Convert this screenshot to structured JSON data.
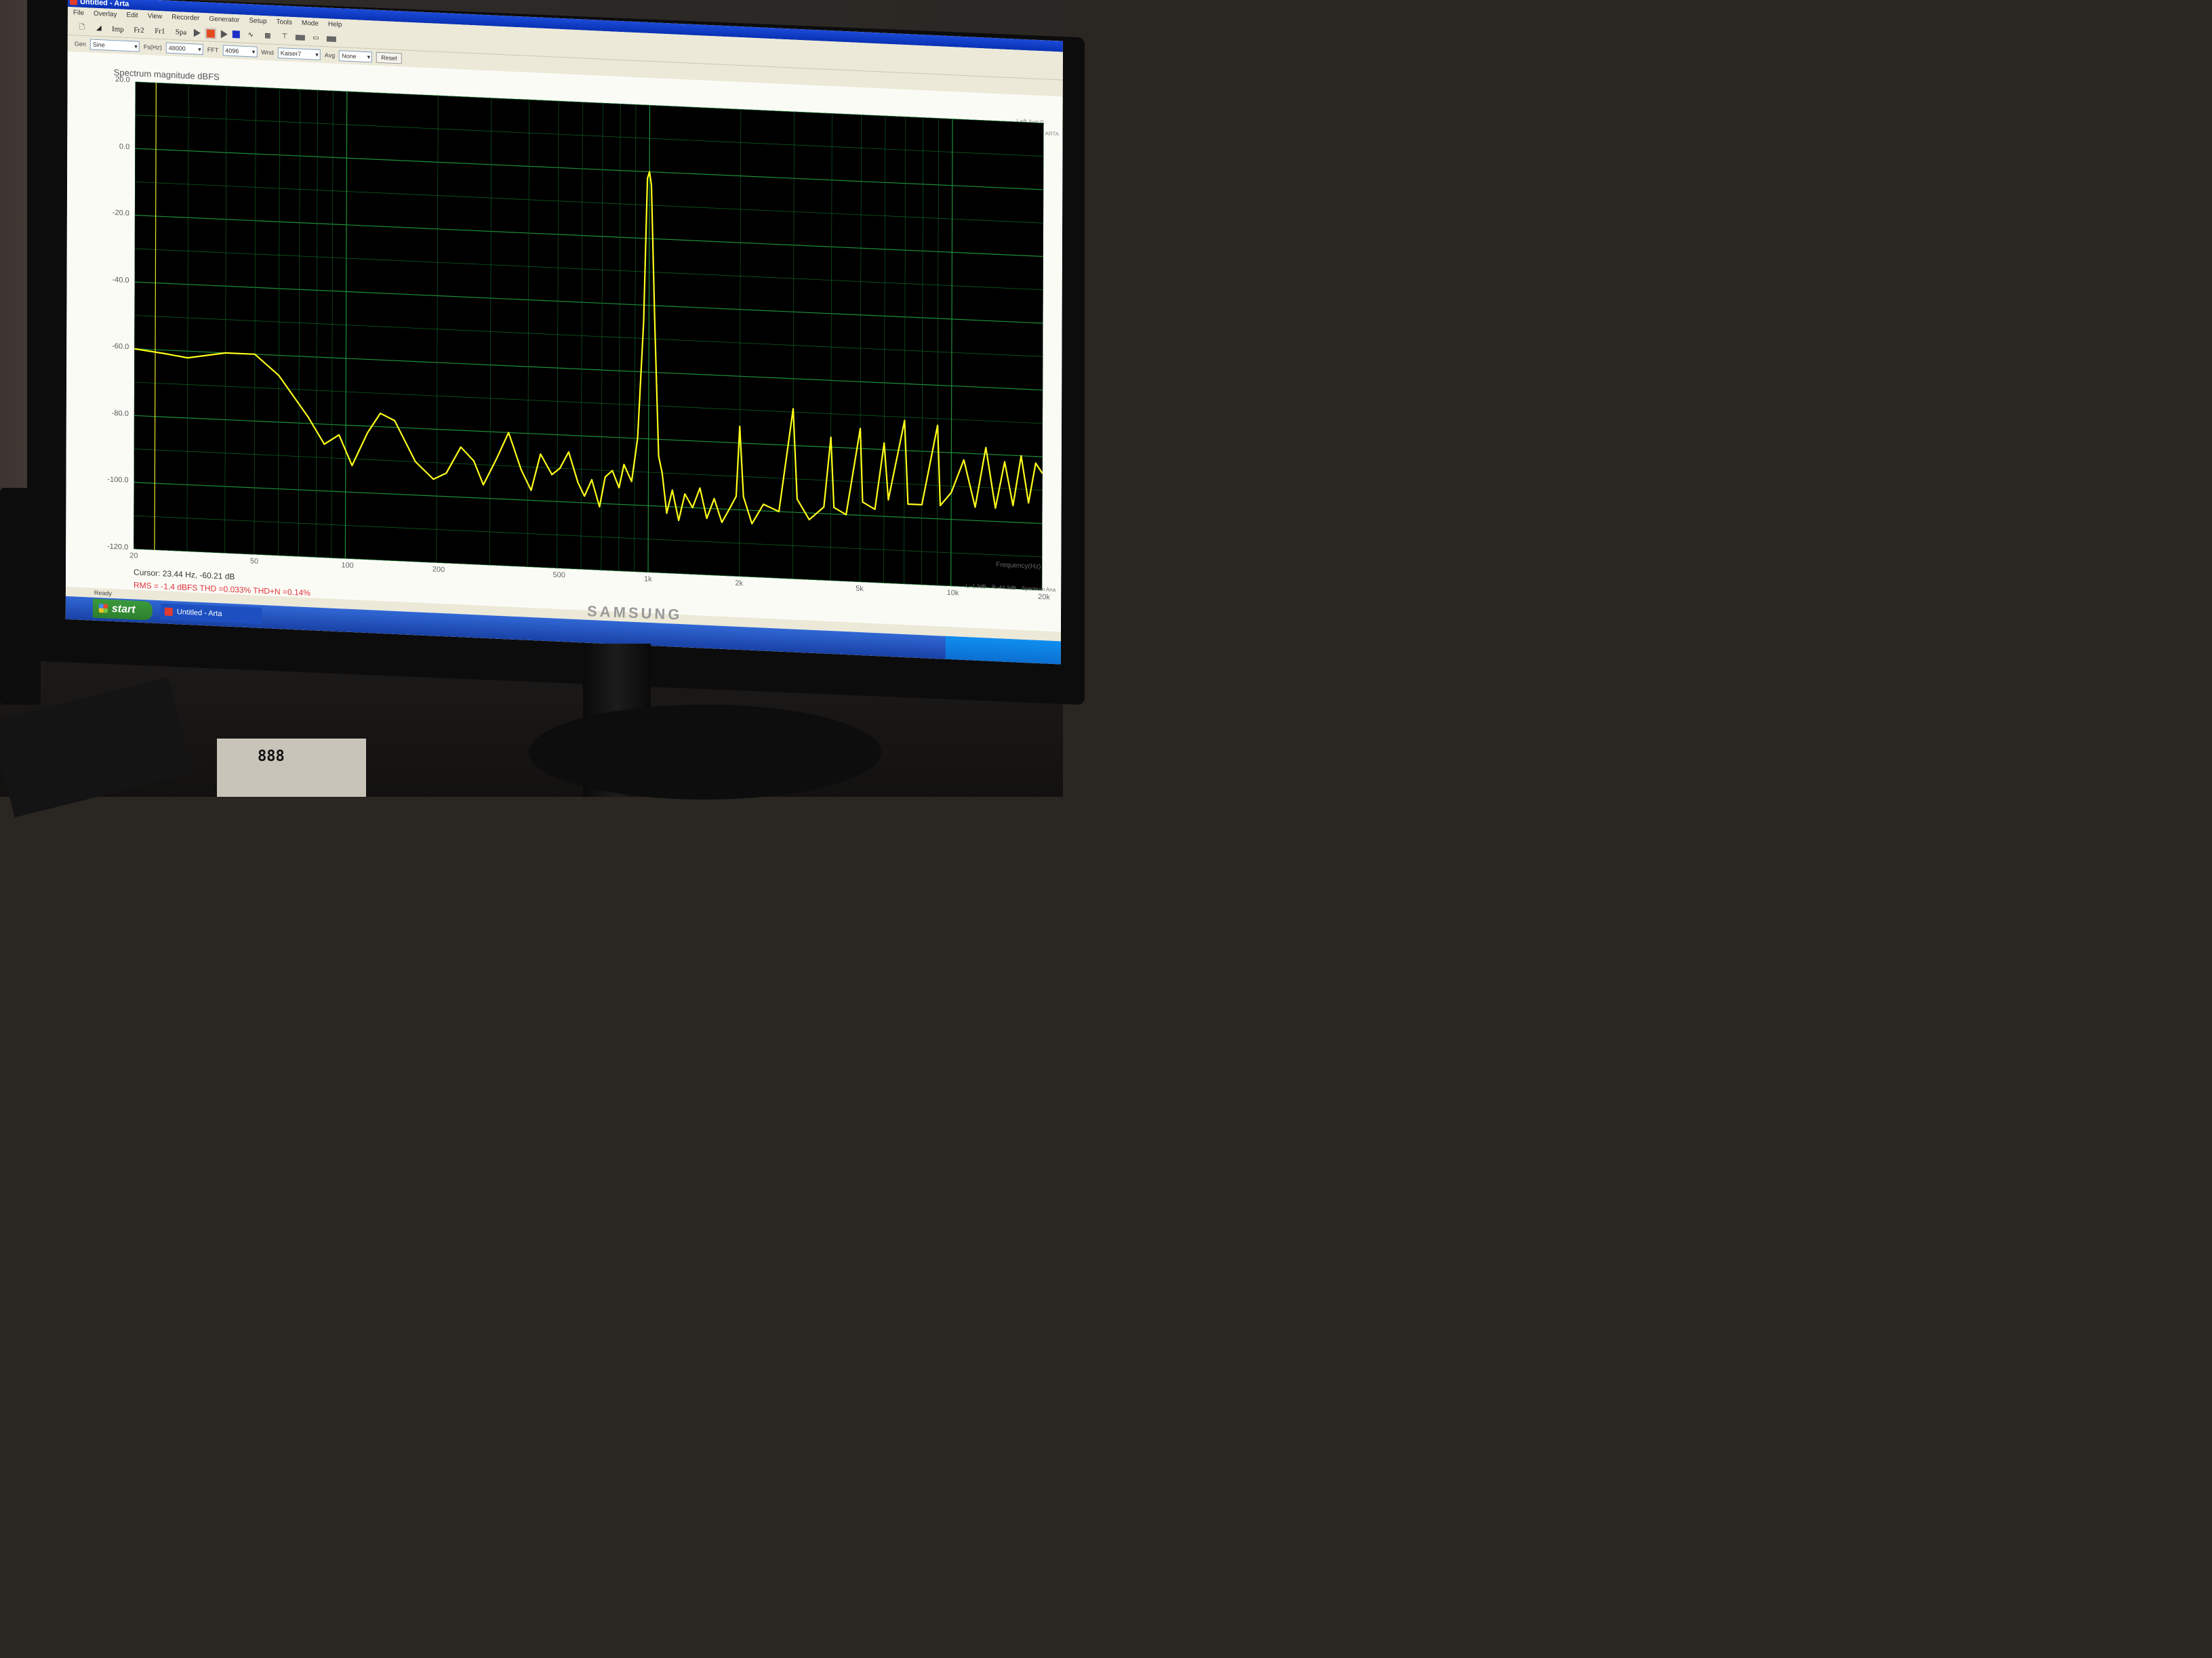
{
  "window": {
    "title": "Untitled - Arta"
  },
  "menu": [
    "File",
    "Overlay",
    "Edit",
    "View",
    "Recorder",
    "Generator",
    "Setup",
    "Tools",
    "Mode",
    "Help"
  ],
  "toolbar": {
    "labels": [
      "Imp",
      "Fr2",
      "Fr1",
      "Spa"
    ]
  },
  "params": {
    "gen_label": "Gen",
    "gen_value": "Sine",
    "fs_label": "Fs(Hz)",
    "fs_value": "48000",
    "fft_label": "FFT",
    "fft_value": "4096",
    "wnd_label": "Wnd",
    "wnd_value": "Kaiser7",
    "avg_label": "Avg",
    "avg_value": "None",
    "reset_label": "Reset"
  },
  "plot": {
    "right_label": "Left Avg:0",
    "side_label": "ARTA"
  },
  "chart_data": {
    "type": "line",
    "title": "Spectrum magnitude dBFS",
    "xlabel": "Frequency(Hz)",
    "ylabel": "",
    "x_scale": "log",
    "xlim": [
      20,
      20000
    ],
    "ylim": [
      -120,
      20
    ],
    "y_ticks": [
      "20.0",
      "0.0",
      "-20.0",
      "-40.0",
      "-60.0",
      "-80.0",
      "-100.0",
      "-120.0"
    ],
    "x_ticks": [
      "20",
      "50",
      "100",
      "200",
      "500",
      "1k",
      "2k",
      "5k",
      "10k",
      "20k"
    ],
    "grid": true,
    "series": [
      {
        "color": "#ffff1a",
        "points": [
          [
            20,
            -60
          ],
          [
            25,
            -61
          ],
          [
            30,
            -62
          ],
          [
            40,
            -60
          ],
          [
            50,
            -60
          ],
          [
            60,
            -66
          ],
          [
            75,
            -78
          ],
          [
            85,
            -86
          ],
          [
            95,
            -83
          ],
          [
            105,
            -92
          ],
          [
            118,
            -82
          ],
          [
            130,
            -76
          ],
          [
            145,
            -78
          ],
          [
            170,
            -90
          ],
          [
            195,
            -95
          ],
          [
            215,
            -93
          ],
          [
            240,
            -85
          ],
          [
            265,
            -89
          ],
          [
            285,
            -96
          ],
          [
            315,
            -88
          ],
          [
            345,
            -80
          ],
          [
            380,
            -91
          ],
          [
            410,
            -97
          ],
          [
            440,
            -86
          ],
          [
            480,
            -92
          ],
          [
            510,
            -90
          ],
          [
            545,
            -85
          ],
          [
            585,
            -94
          ],
          [
            615,
            -98
          ],
          [
            650,
            -93
          ],
          [
            690,
            -101
          ],
          [
            720,
            -92
          ],
          [
            760,
            -90
          ],
          [
            800,
            -95
          ],
          [
            830,
            -88
          ],
          [
            880,
            -93
          ],
          [
            920,
            -80
          ],
          [
            960,
            -45
          ],
          [
            985,
            -2
          ],
          [
            1000,
            0
          ],
          [
            1015,
            -4
          ],
          [
            1045,
            -45
          ],
          [
            1080,
            -85
          ],
          [
            1110,
            -90
          ],
          [
            1150,
            -102
          ],
          [
            1200,
            -95
          ],
          [
            1260,
            -104
          ],
          [
            1320,
            -96
          ],
          [
            1400,
            -100
          ],
          [
            1480,
            -94
          ],
          [
            1560,
            -103
          ],
          [
            1650,
            -97
          ],
          [
            1750,
            -104
          ],
          [
            1850,
            -100
          ],
          [
            1950,
            -96
          ],
          [
            2000,
            -75
          ],
          [
            2060,
            -96
          ],
          [
            2200,
            -104
          ],
          [
            2400,
            -98
          ],
          [
            2700,
            -100
          ],
          [
            3000,
            -69
          ],
          [
            3100,
            -96
          ],
          [
            3400,
            -102
          ],
          [
            3800,
            -98
          ],
          [
            4000,
            -77
          ],
          [
            4100,
            -98
          ],
          [
            4500,
            -100
          ],
          [
            5000,
            -74
          ],
          [
            5100,
            -96
          ],
          [
            5600,
            -98
          ],
          [
            6000,
            -78
          ],
          [
            6200,
            -95
          ],
          [
            7000,
            -71
          ],
          [
            7200,
            -96
          ],
          [
            8000,
            -96
          ],
          [
            9000,
            -72
          ],
          [
            9200,
            -96
          ],
          [
            10000,
            -92
          ],
          [
            11000,
            -82
          ],
          [
            12000,
            -96
          ],
          [
            13000,
            -78
          ],
          [
            14000,
            -96
          ],
          [
            15000,
            -82
          ],
          [
            16000,
            -95
          ],
          [
            17000,
            -80
          ],
          [
            18000,
            -94
          ],
          [
            19000,
            -82
          ],
          [
            20000,
            -85
          ]
        ]
      }
    ]
  },
  "readout": {
    "cursor": "Cursor: 23.44 Hz, -60.21 dB",
    "stats": "RMS =  -1.4 dBFS   THD =0.033%   THD+N =0.14%"
  },
  "status_mini": [
    "L:-1.3dB",
    "R:-44.2dB",
    "Spectrum Ana"
  ],
  "statusbar": {
    "text": "Ready"
  },
  "taskbar": {
    "start_label": "start",
    "task_label": "Untitled - Arta"
  },
  "monitor": {
    "brand": "SAMSUNG"
  },
  "device": {
    "display_digits": "888"
  }
}
